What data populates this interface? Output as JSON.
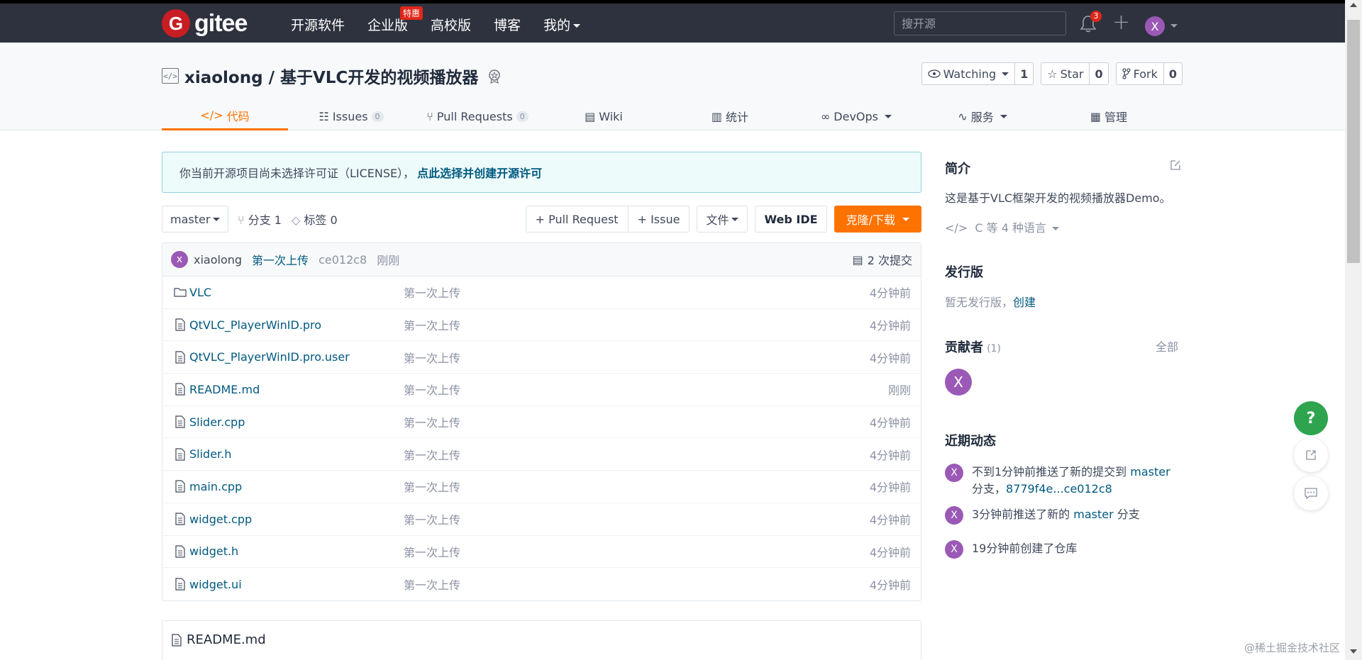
{
  "nav": {
    "logo_letter": "G",
    "logo_text": "gitee",
    "links": [
      "开源软件",
      "企业版",
      "高校版",
      "博客",
      "我的"
    ],
    "enterprise_badge": "特惠",
    "search_placeholder": "搜开源",
    "notification_count": "3",
    "plus": "+",
    "avatar_letter": "X"
  },
  "repo": {
    "title": "xiaolong / 基于VLC开发的视频播放器",
    "watch_label": "Watching",
    "watch_count": "1",
    "star_label": "Star",
    "star_count": "0",
    "fork_label": "Fork",
    "fork_count": "0",
    "tabs": [
      {
        "label": "代码"
      },
      {
        "label": "Issues",
        "count": "0"
      },
      {
        "label": "Pull Requests",
        "count": "0"
      },
      {
        "label": "Wiki"
      },
      {
        "label": "统计"
      },
      {
        "label": "DevOps"
      },
      {
        "label": "服务"
      },
      {
        "label": "管理"
      }
    ]
  },
  "license": {
    "text": "你当前开源项目尚未选择许可证（LICENSE），",
    "link": "点此选择并创建开源许可"
  },
  "toolbar": {
    "branch": "master",
    "branches": "分支 1",
    "tags": "标签 0",
    "pull_request": "+ Pull Request",
    "issue": "+ Issue",
    "files": "文件",
    "web_ide": "Web IDE",
    "clone": "克隆/下载"
  },
  "commit": {
    "avatar": "x",
    "author": "xiaolong",
    "message": "第一次上传",
    "sha": "ce012c8",
    "time": "刚刚",
    "count": "2 次提交"
  },
  "files": [
    {
      "name": "VLC",
      "type": "folder",
      "message": "第一次上传",
      "time": "4分钟前"
    },
    {
      "name": "QtVLC_PlayerWinID.pro",
      "type": "file",
      "message": "第一次上传",
      "time": "4分钟前"
    },
    {
      "name": "QtVLC_PlayerWinID.pro.user",
      "type": "file",
      "message": "第一次上传",
      "time": "4分钟前"
    },
    {
      "name": "README.md",
      "type": "file",
      "message": "第一次上传",
      "time": "刚刚"
    },
    {
      "name": "Slider.cpp",
      "type": "file",
      "message": "第一次上传",
      "time": "4分钟前"
    },
    {
      "name": "Slider.h",
      "type": "file",
      "message": "第一次上传",
      "time": "4分钟前"
    },
    {
      "name": "main.cpp",
      "type": "file",
      "message": "第一次上传",
      "time": "4分钟前"
    },
    {
      "name": "widget.cpp",
      "type": "file",
      "message": "第一次上传",
      "time": "4分钟前"
    },
    {
      "name": "widget.h",
      "type": "file",
      "message": "第一次上传",
      "time": "4分钟前"
    },
    {
      "name": "widget.ui",
      "type": "file",
      "message": "第一次上传",
      "time": "4分钟前"
    }
  ],
  "readme_title": "README.md",
  "sidebar": {
    "intro_title": "简介",
    "intro_text": "这是基于VLC框架开发的视频播放器Demo。",
    "languages": "C 等 4 种语言",
    "releases_title": "发行版",
    "releases_text": "暂无发行版，",
    "releases_create": "创建",
    "contributors_title": "贡献者",
    "contributors_count": "(1)",
    "contributors_all": "全部",
    "contributor_avatar": "X",
    "activity_title": "近期动态",
    "activities": [
      {
        "avatar": "X",
        "text_prefix": "不到1分钟前推送了新的提交到 ",
        "link": "master",
        "text_suffix": " 分支，",
        "link2": "8779f4e...ce012c8"
      },
      {
        "avatar": "X",
        "text_prefix": "3分钟前推送了新的 ",
        "link": "master",
        "text_suffix": " 分支"
      },
      {
        "avatar": "X",
        "text_prefix": "19分钟前创建了仓库"
      }
    ]
  },
  "float": {
    "help": "?"
  },
  "watermark": "@稀土掘金技术社区",
  "colors": {
    "accent": "#fe7300",
    "nav_bg": "#2e323e",
    "link": "#005980",
    "avatar": "#9b59b6",
    "help": "#2ea44f"
  }
}
